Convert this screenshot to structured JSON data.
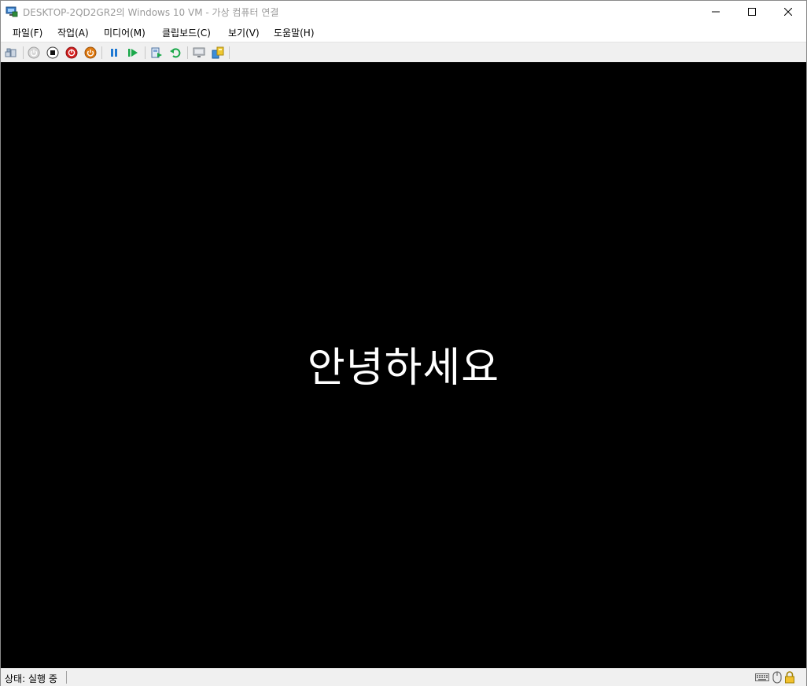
{
  "window": {
    "title": "DESKTOP-2QD2GR2의 Windows 10 VM - 가상 컴퓨터 연결"
  },
  "menu": {
    "items": [
      {
        "label": "파일(F)"
      },
      {
        "label": "작업(A)"
      },
      {
        "label": "미디어(M)"
      },
      {
        "label": "클립보드(C)"
      },
      {
        "label": "보기(V)"
      },
      {
        "label": "도움말(H)"
      }
    ]
  },
  "toolbar": {
    "icons": [
      "ctrl-alt-del-icon",
      "start-icon",
      "turn-off-icon",
      "shutdown-icon",
      "power-icon",
      "pause-icon",
      "resume-icon",
      "checkpoint-icon",
      "revert-icon",
      "enhanced-session-icon",
      "share-icon"
    ]
  },
  "vm": {
    "greeting": "안녕하세요",
    "background": "#000000"
  },
  "status": {
    "text": "상태: 실행 중",
    "icons": [
      "keyboard-icon",
      "mouse-icon",
      "lock-icon"
    ]
  },
  "colors": {
    "shutdown_red": "#d42020",
    "power_orange": "#e07a10",
    "pause_blue": "#1e78d2",
    "resume_green": "#1aa84a"
  }
}
